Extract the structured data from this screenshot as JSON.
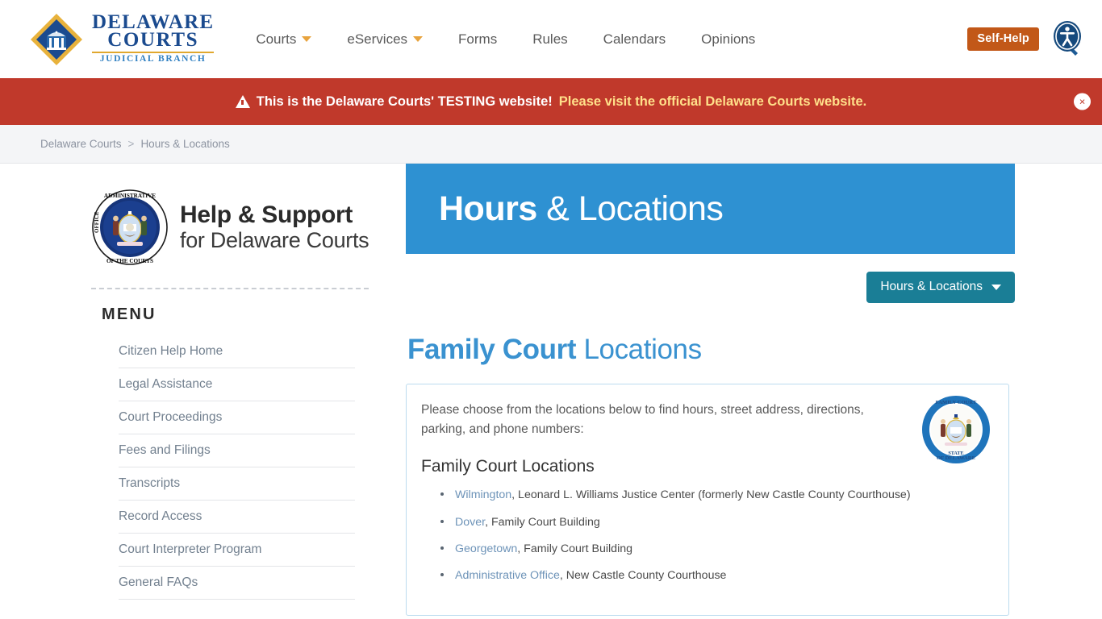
{
  "header": {
    "brand": {
      "line1": "DELAWARE",
      "line2": "COURTS",
      "line3": "JUDICIAL BRANCH",
      "logo_icon": "delaware-courts-diamond-logo"
    },
    "nav": [
      {
        "label": "Courts",
        "has_dropdown": true
      },
      {
        "label": "eServices",
        "has_dropdown": true
      },
      {
        "label": "Forms",
        "has_dropdown": false
      },
      {
        "label": "Rules",
        "has_dropdown": false
      },
      {
        "label": "Calendars",
        "has_dropdown": false
      },
      {
        "label": "Opinions",
        "has_dropdown": false
      }
    ],
    "self_help_label": "Self-Help",
    "accessibility_icon": "accessibility-magnifier-icon"
  },
  "alert": {
    "warning_icon": "warning-triangle-icon",
    "text_white": "This is the Delaware Courts' TESTING website!",
    "text_yellow": "Please visit the official Delaware Courts website.",
    "close_label": "×",
    "bg_color": "#c0392b"
  },
  "breadcrumb": {
    "home": "Delaware Courts",
    "separator": ">",
    "current": "Hours & Locations"
  },
  "sidebar": {
    "seal_icon": "administrative-office-of-the-courts-seal",
    "seal_text_outer": "ADMINISTRATIVE · OFFICE OF THE COURTS ·",
    "help_title_line1": "Help & Support",
    "help_title_line2": "for Delaware Courts",
    "menu_heading": "MENU",
    "items": [
      {
        "label": "Citizen Help Home"
      },
      {
        "label": "Legal Assistance"
      },
      {
        "label": "Court Proceedings"
      },
      {
        "label": "Fees and Filings"
      },
      {
        "label": "Transcripts"
      },
      {
        "label": "Record Access"
      },
      {
        "label": "Court Interpreter Program"
      },
      {
        "label": "General FAQs"
      }
    ]
  },
  "main": {
    "hero_bold": "Hours",
    "hero_light": " & Locations",
    "hero_bg_color": "#2e91d2",
    "dropdown_label": "Hours & Locations",
    "dropdown_icon": "chevron-down-icon",
    "dropdown_bg_color": "#1a7e96",
    "section_title_bold": "Family Court",
    "section_title_light": " Locations",
    "card": {
      "intro": "Please choose from the locations below to find hours, street address, directions, parking, and phone numbers:",
      "subheading": "Family Court Locations",
      "seal_icon": "family-court-state-of-delaware-seal",
      "locations": [
        {
          "link": "Wilmington",
          "rest": ", Leonard L. Williams Justice Center (formerly New Castle County Courthouse)"
        },
        {
          "link": "Dover",
          "rest": ", Family Court Building"
        },
        {
          "link": "Georgetown",
          "rest": ", Family Court Building"
        },
        {
          "link": "Administrative Office",
          "rest": ", New Castle County Courthouse"
        }
      ]
    }
  }
}
